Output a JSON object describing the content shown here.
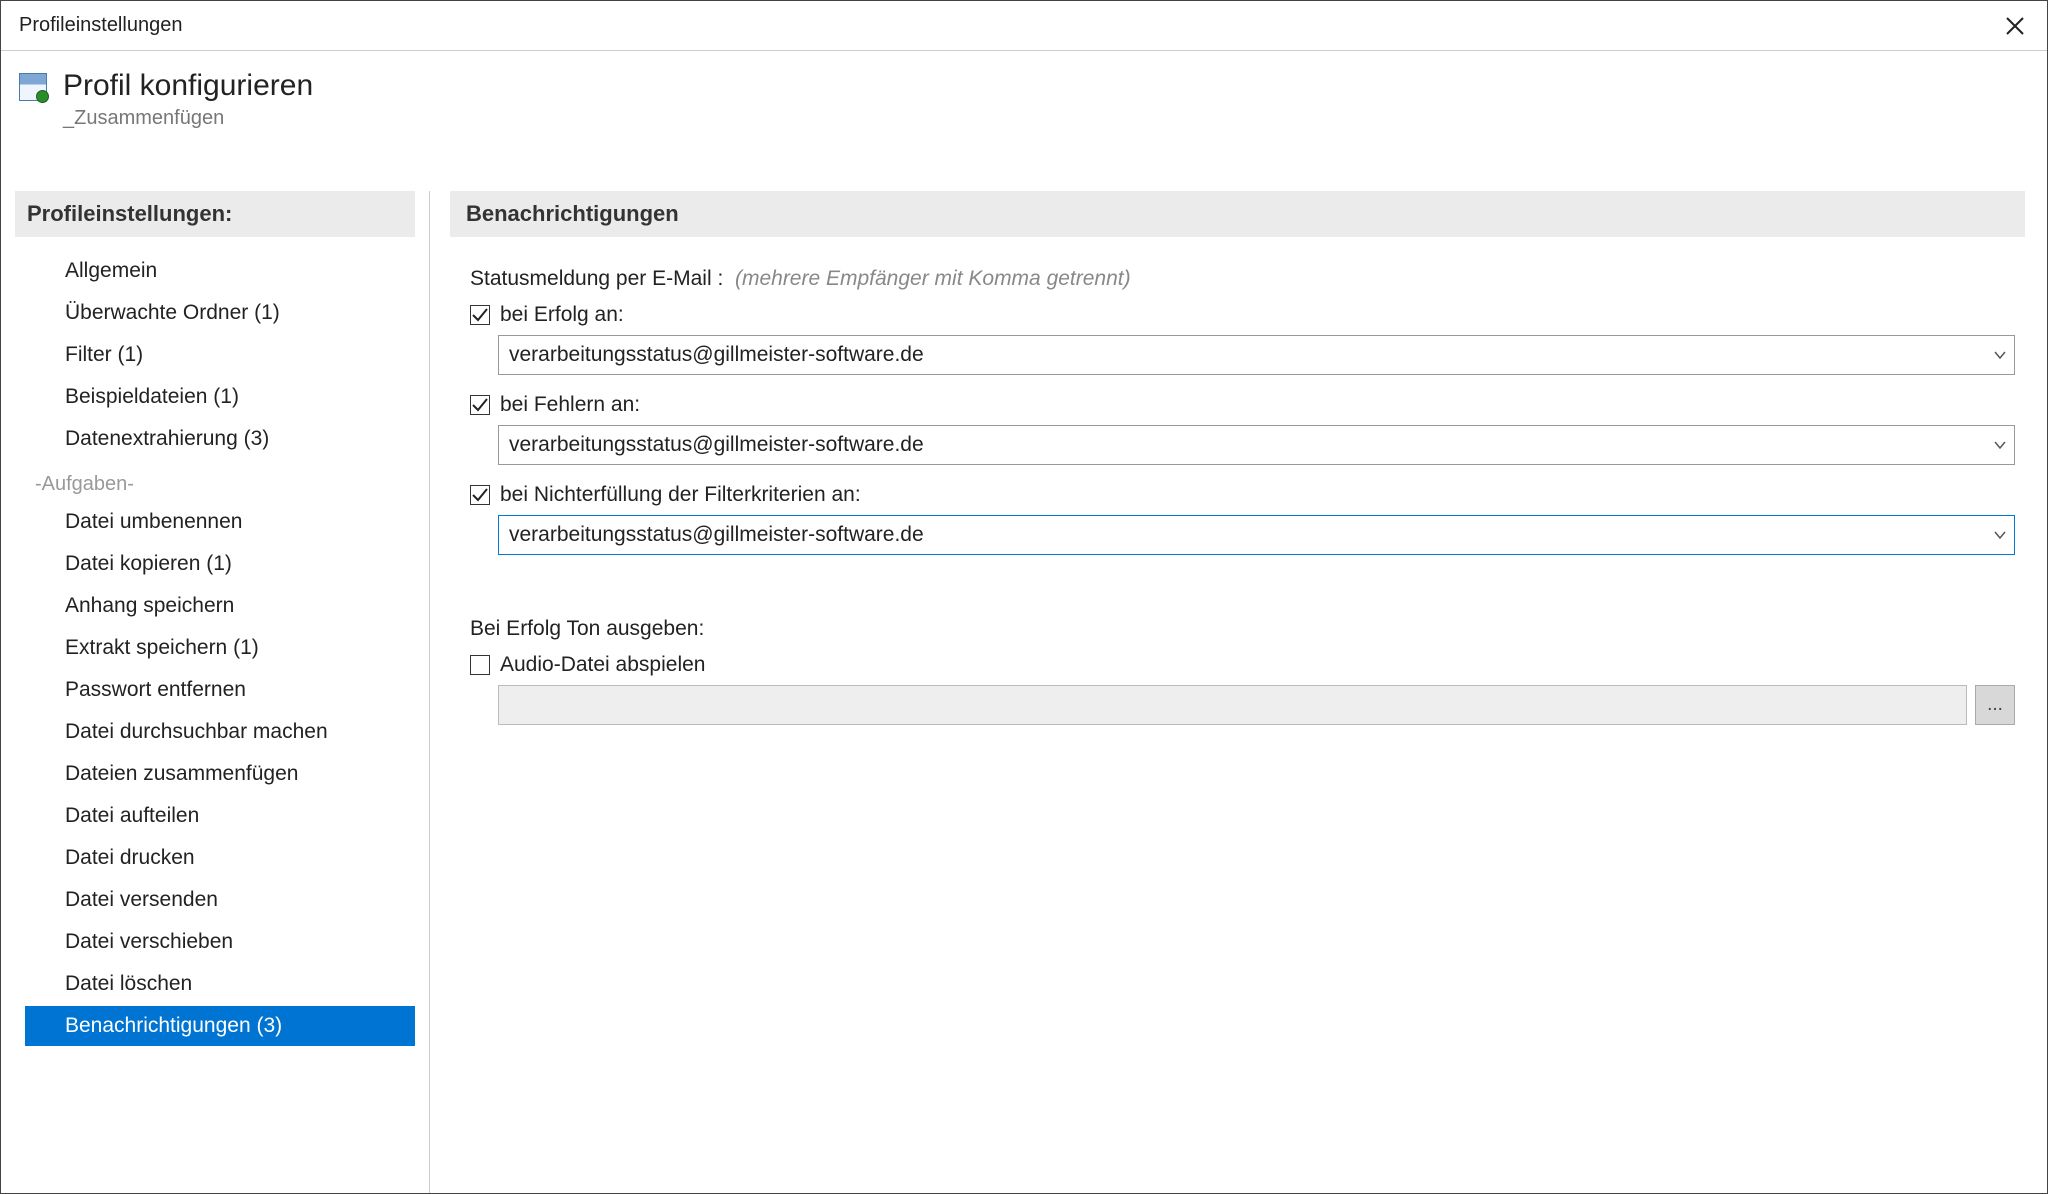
{
  "window": {
    "title": "Profileinstellungen"
  },
  "header": {
    "title": "Profil konfigurieren",
    "subtitle": "_Zusammenfügen"
  },
  "sidebar": {
    "header": "Profileinstellungen:",
    "items_top": [
      {
        "label": "Allgemein"
      },
      {
        "label": "Überwachte Ordner (1)"
      },
      {
        "label": "Filter (1)"
      },
      {
        "label": "Beispieldateien (1)"
      },
      {
        "label": "Datenextrahierung (3)"
      }
    ],
    "group_label": "-Aufgaben-",
    "items_tasks": [
      {
        "label": "Datei umbenennen"
      },
      {
        "label": "Datei kopieren (1)"
      },
      {
        "label": "Anhang speichern"
      },
      {
        "label": "Extrakt speichern (1)"
      },
      {
        "label": "Passwort entfernen"
      },
      {
        "label": "Datei durchsuchbar machen"
      },
      {
        "label": "Dateien zusammenfügen"
      },
      {
        "label": "Datei aufteilen"
      },
      {
        "label": "Datei drucken"
      },
      {
        "label": "Datei versenden"
      },
      {
        "label": "Datei verschieben"
      },
      {
        "label": "Datei löschen"
      }
    ],
    "item_selected": {
      "label": "Benachrichtigungen (3)"
    }
  },
  "main": {
    "header": "Benachrichtigungen",
    "status_email_label": "Statusmeldung per E-Mail :",
    "status_email_hint": "(mehrere Empfänger mit Komma getrennt)",
    "on_success": {
      "checked": true,
      "label": "bei Erfolg an:",
      "value": "verarbeitungsstatus@gillmeister-software.de"
    },
    "on_error": {
      "checked": true,
      "label": "bei Fehlern an:",
      "value": "verarbeitungsstatus@gillmeister-software.de"
    },
    "on_filterfail": {
      "checked": true,
      "label": "bei Nichterfüllung der Filterkriterien an:",
      "value": "verarbeitungsstatus@gillmeister-software.de"
    },
    "sound_section_label": "Bei Erfolg Ton ausgeben:",
    "play_audio": {
      "checked": false,
      "label": "Audio-Datei abspielen",
      "path": ""
    },
    "browse_label": "..."
  }
}
